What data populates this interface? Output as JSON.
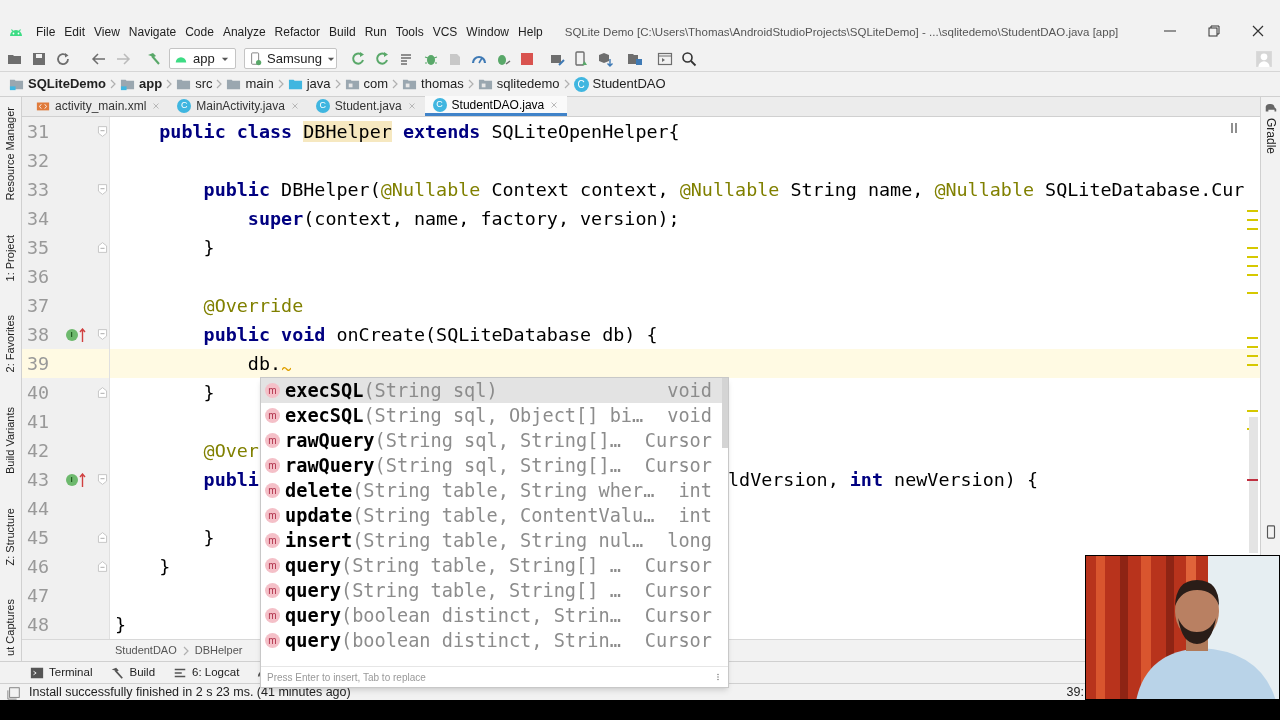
{
  "title_bar": {
    "menu": [
      "File",
      "Edit",
      "View",
      "Navigate",
      "Code",
      "Analyze",
      "Refactor",
      "Build",
      "Run",
      "Tools",
      "VCS",
      "Window",
      "Help"
    ],
    "title": "SQLite Demo [C:\\Users\\Thomas\\AndroidStudioProjects\\SQLiteDemo] - ...\\sqlitedemo\\StudentDAO.java [app]"
  },
  "toolbar": {
    "run_config": "app",
    "device": "Samsung"
  },
  "breadcrumbs": [
    {
      "label": "SQLiteDemo",
      "kind": "module"
    },
    {
      "label": "app",
      "kind": "module"
    },
    {
      "label": "src",
      "kind": "folder"
    },
    {
      "label": "main",
      "kind": "folder"
    },
    {
      "label": "java",
      "kind": "source"
    },
    {
      "label": "com",
      "kind": "package"
    },
    {
      "label": "thomas",
      "kind": "package"
    },
    {
      "label": "sqlitedemo",
      "kind": "package"
    },
    {
      "label": "StudentDAO",
      "kind": "class",
      "icon_letter": "C"
    }
  ],
  "tabs": [
    {
      "label": "activity_main.xml",
      "kind": "xml",
      "selected": false
    },
    {
      "label": "MainActivity.java",
      "kind": "class",
      "icon_letter": "C",
      "selected": false
    },
    {
      "label": "Student.java",
      "kind": "class",
      "icon_letter": "C",
      "selected": false
    },
    {
      "label": "StudentDAO.java",
      "kind": "class",
      "icon_letter": "C",
      "selected": true
    }
  ],
  "left_tool_tabs": [
    "Resource Manager",
    "1: Project",
    "2: Favorites",
    "Build Variants",
    "Z: Structure",
    "ut Captures"
  ],
  "right_tool_tabs": [
    "Gradle"
  ],
  "editor": {
    "lines": [
      {
        "number": "31",
        "fold_open": true,
        "segments": [
          {
            "t": "    public class ",
            "kind": "kw"
          },
          {
            "t": "DBHelper",
            "kind": "hl"
          },
          {
            "t": " extends",
            "kind": "kw"
          },
          {
            "t": " SQLiteOpenHelper{",
            "kind": "id"
          }
        ]
      },
      {
        "number": "32"
      },
      {
        "number": "33",
        "fold_open": true,
        "segments": [
          {
            "t": "        public",
            "kind": "kw"
          },
          {
            "t": " DBHelper(",
            "kind": "id"
          },
          {
            "t": "@Nullable",
            "kind": "ann"
          },
          {
            "t": " Context context, ",
            "kind": "id"
          },
          {
            "t": "@Nullable",
            "kind": "ann"
          },
          {
            "t": " String name, ",
            "kind": "id"
          },
          {
            "t": "@Nullable",
            "kind": "ann"
          },
          {
            "t": " SQLiteDatabase.Cur",
            "kind": "id"
          }
        ]
      },
      {
        "number": "34",
        "segments": [
          {
            "t": "            super",
            "kind": "kw"
          },
          {
            "t": "(context, name, factory, version);",
            "kind": "id"
          }
        ]
      },
      {
        "number": "35",
        "fold_close": true,
        "segments": [
          {
            "t": "        }",
            "kind": "id"
          }
        ]
      },
      {
        "number": "36"
      },
      {
        "number": "37",
        "segments": [
          {
            "t": "        @Override",
            "kind": "ann"
          }
        ]
      },
      {
        "number": "38",
        "fold_open": true,
        "override_marker": "I",
        "segments": [
          {
            "t": "        public void",
            "kind": "kw"
          },
          {
            "t": " onCreate(SQLiteDatabase db) {",
            "kind": "id"
          }
        ]
      },
      {
        "number": "39",
        "current": true,
        "segments": [
          {
            "t": "            db.",
            "kind": "id"
          }
        ]
      },
      {
        "number": "40",
        "fold_close": true,
        "segments": [
          {
            "t": "        }",
            "kind": "id"
          }
        ]
      },
      {
        "number": "41"
      },
      {
        "number": "42",
        "segments": [
          {
            "t": "        @Over",
            "kind": "ann"
          }
        ]
      },
      {
        "number": "43",
        "fold_open": true,
        "override_marker": "I",
        "segments": [
          {
            "t": "        publi",
            "kind": "kw"
          }
        ],
        "segments_after_popup": [
          {
            "t": "ldVersion, ",
            "kind": "id"
          },
          {
            "t": "int",
            "kind": "kw"
          },
          {
            "t": " newVersion) {",
            "kind": "id"
          }
        ]
      },
      {
        "number": "44"
      },
      {
        "number": "45",
        "fold_close": true,
        "segments": [
          {
            "t": "        }",
            "kind": "id"
          }
        ]
      },
      {
        "number": "46",
        "fold_close": true,
        "segments": [
          {
            "t": "    }",
            "kind": "id"
          }
        ]
      },
      {
        "number": "47"
      },
      {
        "number": "48",
        "segments": [
          {
            "t": "}",
            "kind": "id"
          }
        ]
      }
    ],
    "breadcrumb": [
      "StudentDAO",
      "DBHelper"
    ]
  },
  "completion": {
    "items": [
      {
        "badge": "m",
        "name": "execSQL",
        "params": "(String sql)",
        "type": "void",
        "selected": true
      },
      {
        "badge": "m",
        "name": "execSQL",
        "params": "(String sql, Object[] bi…",
        "type": "void",
        "selected": false
      },
      {
        "badge": "m",
        "name": "rawQuery",
        "params": "(String sql, String[]…",
        "type": "Cursor",
        "selected": false
      },
      {
        "badge": "m",
        "name": "rawQuery",
        "params": "(String sql, String[]…",
        "type": "Cursor",
        "selected": false
      },
      {
        "badge": "m",
        "name": "delete",
        "params": "(String table, String wher…",
        "type": "int",
        "selected": false
      },
      {
        "badge": "m",
        "name": "update",
        "params": "(String table, ContentValu…",
        "type": "int",
        "selected": false
      },
      {
        "badge": "m",
        "name": "insert",
        "params": "(String table, String nul…",
        "type": "long",
        "selected": false
      },
      {
        "badge": "m",
        "name": "query",
        "params": "(String table, String[] …",
        "type": "Cursor",
        "selected": false
      },
      {
        "badge": "m",
        "name": "query",
        "params": "(String table, String[] …",
        "type": "Cursor",
        "selected": false
      },
      {
        "badge": "m",
        "name": "query",
        "params": "(boolean distinct, Strin…",
        "type": "Cursor",
        "selected": false
      },
      {
        "badge": "m",
        "name": "query",
        "params": "(boolean distinct, Strin…",
        "type": "Cursor",
        "selected": false
      }
    ],
    "hint": "Press Enter to insert, Tab to replace"
  },
  "tool_tabs": [
    "Terminal",
    "Build",
    "6: Logcat"
  ],
  "status_bar": {
    "message": "Install successfully finished in 2 s 23 ms. (41 minutes ago)",
    "position": "39:"
  },
  "webcam": {
    "kind": "picture"
  }
}
